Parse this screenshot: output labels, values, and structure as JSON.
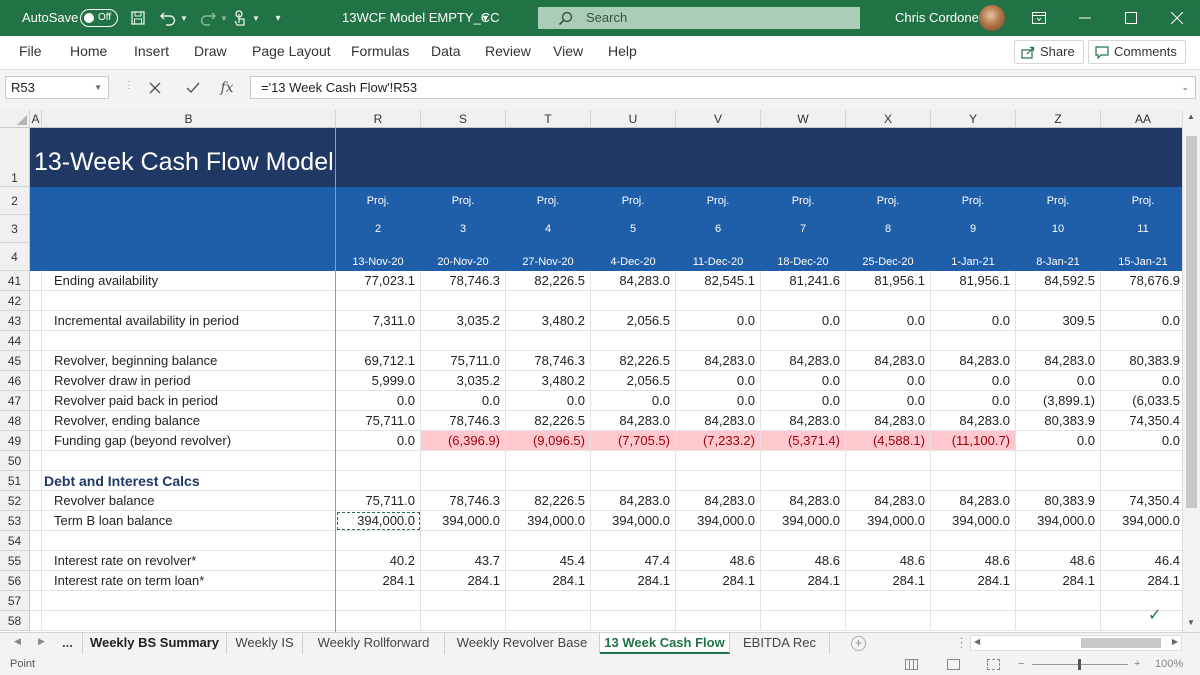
{
  "titlebar": {
    "autosave_label": "AutoSave",
    "autosave_state": "Off",
    "file_name": "13WCF Model EMPTY_CC",
    "search_placeholder": "Search",
    "user_name": "Chris Cordone"
  },
  "ribbon": {
    "tabs": [
      "File",
      "Home",
      "Insert",
      "Draw",
      "Page Layout",
      "Formulas",
      "Data",
      "Review",
      "View",
      "Help"
    ],
    "share_label": "Share",
    "comments_label": "Comments"
  },
  "formula_bar": {
    "name_box": "R53",
    "fx_label": "fx",
    "formula": "='13 Week Cash Flow'!R53"
  },
  "grid": {
    "columns": [
      "A",
      "B",
      "R",
      "S",
      "T",
      "U",
      "V",
      "W",
      "X",
      "Y",
      "Z",
      "AA"
    ],
    "title": "13-Week Cash Flow Model",
    "header_row_numbers": [
      "1",
      "2",
      "3",
      "4"
    ],
    "proj_label": "Proj.",
    "periods": [
      "2",
      "3",
      "4",
      "5",
      "6",
      "7",
      "8",
      "9",
      "10",
      "11"
    ],
    "dates": [
      "13-Nov-20",
      "20-Nov-20",
      "27-Nov-20",
      "4-Dec-20",
      "11-Dec-20",
      "18-Dec-20",
      "25-Dec-20",
      "1-Jan-21",
      "8-Jan-21",
      "15-Jan-21"
    ],
    "rows": [
      {
        "num": "41",
        "label": "Ending availability",
        "values": [
          "77,023.1",
          "78,746.3",
          "82,226.5",
          "84,283.0",
          "82,545.1",
          "81,241.6",
          "81,956.1",
          "81,956.1",
          "84,592.5",
          "78,676.9"
        ]
      },
      {
        "num": "42",
        "label": "",
        "values": []
      },
      {
        "num": "43",
        "label": "Incremental availability in period",
        "values": [
          "7,311.0",
          "3,035.2",
          "3,480.2",
          "2,056.5",
          "0.0",
          "0.0",
          "0.0",
          "0.0",
          "309.5",
          "0.0"
        ]
      },
      {
        "num": "44",
        "label": "",
        "values": []
      },
      {
        "num": "45",
        "label": "Revolver, beginning balance",
        "values": [
          "69,712.1",
          "75,711.0",
          "78,746.3",
          "82,226.5",
          "84,283.0",
          "84,283.0",
          "84,283.0",
          "84,283.0",
          "84,283.0",
          "80,383.9"
        ]
      },
      {
        "num": "46",
        "label": "Revolver draw in period",
        "values": [
          "5,999.0",
          "3,035.2",
          "3,480.2",
          "2,056.5",
          "0.0",
          "0.0",
          "0.0",
          "0.0",
          "0.0",
          "0.0"
        ]
      },
      {
        "num": "47",
        "label": "Revolver paid back in period",
        "values": [
          "0.0",
          "0.0",
          "0.0",
          "0.0",
          "0.0",
          "0.0",
          "0.0",
          "0.0",
          "(3,899.1)",
          "(6,033.5"
        ]
      },
      {
        "num": "48",
        "label": "Revolver, ending balance",
        "values": [
          "75,711.0",
          "78,746.3",
          "82,226.5",
          "84,283.0",
          "84,283.0",
          "84,283.0",
          "84,283.0",
          "84,283.0",
          "80,383.9",
          "74,350.4"
        ]
      },
      {
        "num": "49",
        "label": "Funding gap (beyond revolver)",
        "values": [
          "0.0",
          "(6,396.9)",
          "(9,096.5)",
          "(7,705.5)",
          "(7,233.2)",
          "(5,371.4)",
          "(4,588.1)",
          "(11,100.7)",
          "0.0",
          "0.0"
        ],
        "highlight": [
          1,
          2,
          3,
          4,
          5,
          6,
          7
        ]
      },
      {
        "num": "50",
        "label": "",
        "values": []
      },
      {
        "num": "51",
        "label": "Debt and Interest Calcs",
        "values": [],
        "section": true
      },
      {
        "num": "52",
        "label": "Revolver balance",
        "values": [
          "75,711.0",
          "78,746.3",
          "82,226.5",
          "84,283.0",
          "84,283.0",
          "84,283.0",
          "84,283.0",
          "84,283.0",
          "80,383.9",
          "74,350.4"
        ]
      },
      {
        "num": "53",
        "label": "Term B loan balance",
        "values": [
          "394,000.0",
          "394,000.0",
          "394,000.0",
          "394,000.0",
          "394,000.0",
          "394,000.0",
          "394,000.0",
          "394,000.0",
          "394,000.0",
          "394,000.0"
        ],
        "selected": 0
      },
      {
        "num": "54",
        "label": "",
        "values": []
      },
      {
        "num": "55",
        "label": "Interest rate on revolver*",
        "values": [
          "40.2",
          "43.7",
          "45.4",
          "47.4",
          "48.6",
          "48.6",
          "48.6",
          "48.6",
          "48.6",
          "46.4"
        ]
      },
      {
        "num": "56",
        "label": "Interest rate on term loan*",
        "values": [
          "284.1",
          "284.1",
          "284.1",
          "284.1",
          "284.1",
          "284.1",
          "284.1",
          "284.1",
          "284.1",
          "284.1"
        ]
      },
      {
        "num": "57",
        "label": "",
        "values": []
      },
      {
        "num": "58",
        "label": "",
        "values": []
      }
    ]
  },
  "sheet_tabs": {
    "ellipsis": "...",
    "tabs": [
      "Weekly BS Summary",
      "Weekly IS",
      "Weekly Rollforward",
      "Weekly Revolver Base",
      "13 Week Cash Flow",
      "EBITDA Rec"
    ],
    "active": 4
  },
  "status_bar": {
    "mode": "Point",
    "zoom": "100%"
  },
  "colors": {
    "excel_green": "#217346",
    "title_navy": "#1f3864",
    "header_blue": "#1f5ea8",
    "bad_fill": "#ffc7ce",
    "bad_text": "#9c0006"
  }
}
